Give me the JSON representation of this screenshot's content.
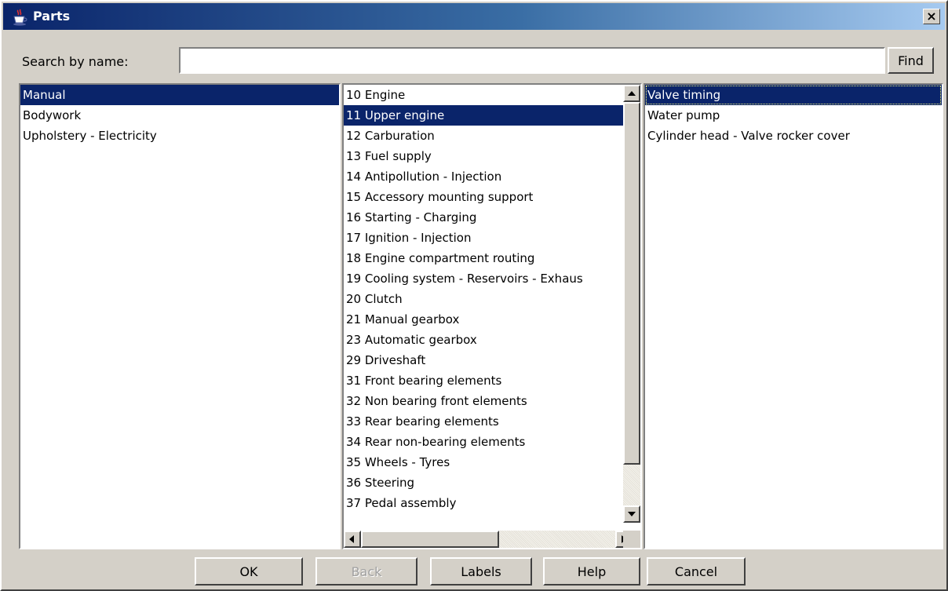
{
  "window": {
    "title": "Parts",
    "close_label": "×"
  },
  "search": {
    "label": "Search by name:",
    "value": "",
    "placeholder": "",
    "find_label": "Find"
  },
  "left_list": [
    "Manual",
    "Bodywork",
    "Upholstery - Electricity"
  ],
  "middle_list": [
    "10 Engine",
    "11 Upper engine",
    "12 Carburation",
    "13 Fuel supply",
    "14 Antipollution - Injection",
    "15 Accessory mounting support",
    "16 Starting - Charging",
    "17 Ignition - Injection",
    "18 Engine compartment routing",
    "19 Cooling system - Reservoirs - Exhaus",
    "20 Clutch",
    "21 Manual gearbox",
    "23 Automatic gearbox",
    "29 Driveshaft",
    "31 Front bearing elements",
    "32 Non bearing front elements",
    "33 Rear bearing elements",
    "34 Rear non-bearing elements",
    "35 Wheels - Tyres",
    "36 Steering",
    "37 Pedal assembly"
  ],
  "right_list": [
    "Valve timing",
    "Water pump",
    "Cylinder head - Valve rocker cover"
  ],
  "selection": {
    "left": "Manual",
    "middle": "11 Upper engine",
    "right": "Valve timing"
  },
  "buttons": {
    "ok": "OK",
    "back": "Back",
    "labels": "Labels",
    "help": "Help",
    "cancel": "Cancel"
  },
  "colors": {
    "selection": "#0a246a",
    "title_start": "#0a246a",
    "title_end": "#a6caf0",
    "face": "#d4d0c8"
  }
}
